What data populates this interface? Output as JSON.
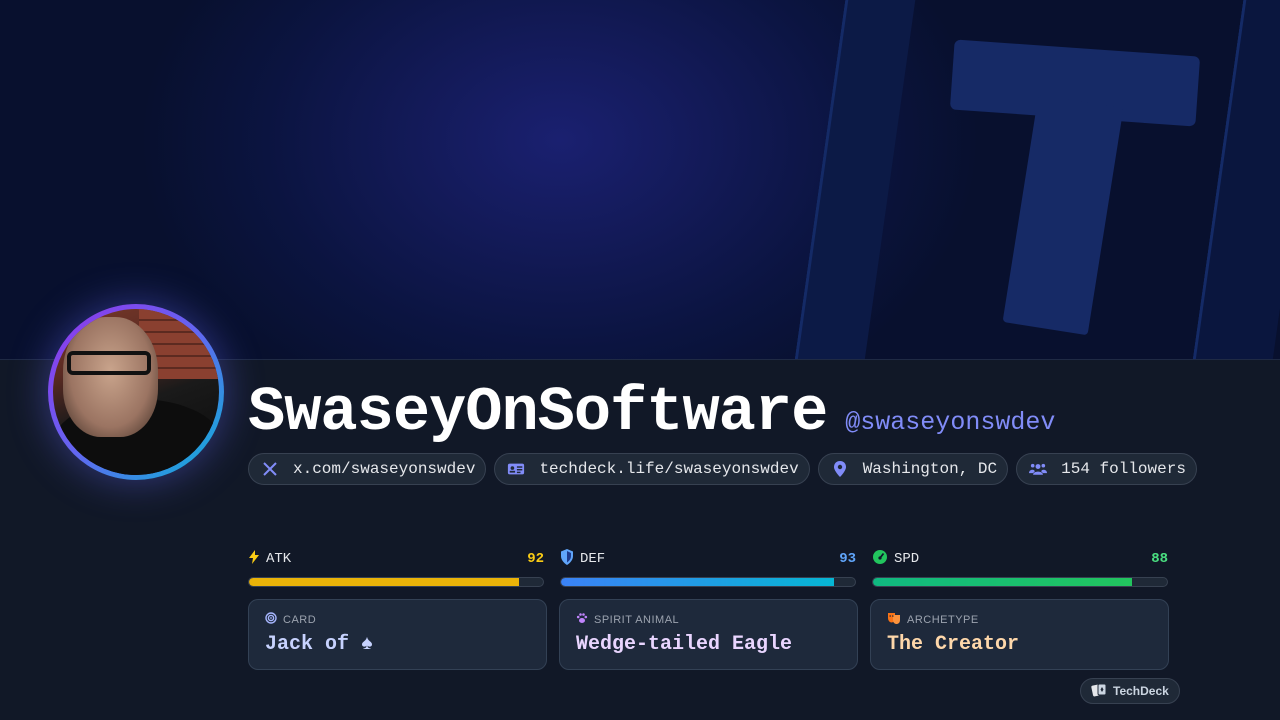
{
  "profile": {
    "name": "SwaseyOnSoftware",
    "handle": "@swaseyonswdev"
  },
  "links": [
    {
      "icon": "x-logo-icon",
      "text": "x.com/swaseyonswdev"
    },
    {
      "icon": "id-card-icon",
      "text": "techdeck.life/swaseyonswdev"
    },
    {
      "icon": "location-pin-icon",
      "text": "Washington, DC"
    },
    {
      "icon": "users-icon",
      "text": "154 followers"
    }
  ],
  "stats": [
    {
      "label": "ATK",
      "value": "92",
      "fill": 0.92,
      "icon": "lightning-icon",
      "color": "#facc15"
    },
    {
      "label": "DEF",
      "value": "93",
      "fill": 0.93,
      "icon": "shield-icon",
      "color": "#60a5fa"
    },
    {
      "label": "SPD",
      "value": "88",
      "fill": 0.88,
      "icon": "speedometer-icon",
      "color": "#4ade80"
    }
  ],
  "cards": [
    {
      "label": "CARD",
      "value": "Jack of ♠",
      "icon": "target-icon",
      "color": "#c7d2fe"
    },
    {
      "label": "SPIRIT ANIMAL",
      "value": "Wedge-tailed Eagle",
      "icon": "paw-icon",
      "color": "#e9d5ff"
    },
    {
      "label": "ARCHETYPE",
      "value": "The Creator",
      "icon": "theater-masks-icon",
      "color": "#fed7aa"
    }
  ],
  "brand": {
    "label": "TechDeck",
    "icon": "cards-icon"
  },
  "colors": {
    "accent": "#818cf8",
    "atk_bar": "#eab308",
    "def_bar": "#0ea5e9",
    "spd_bar": "#10b981"
  }
}
